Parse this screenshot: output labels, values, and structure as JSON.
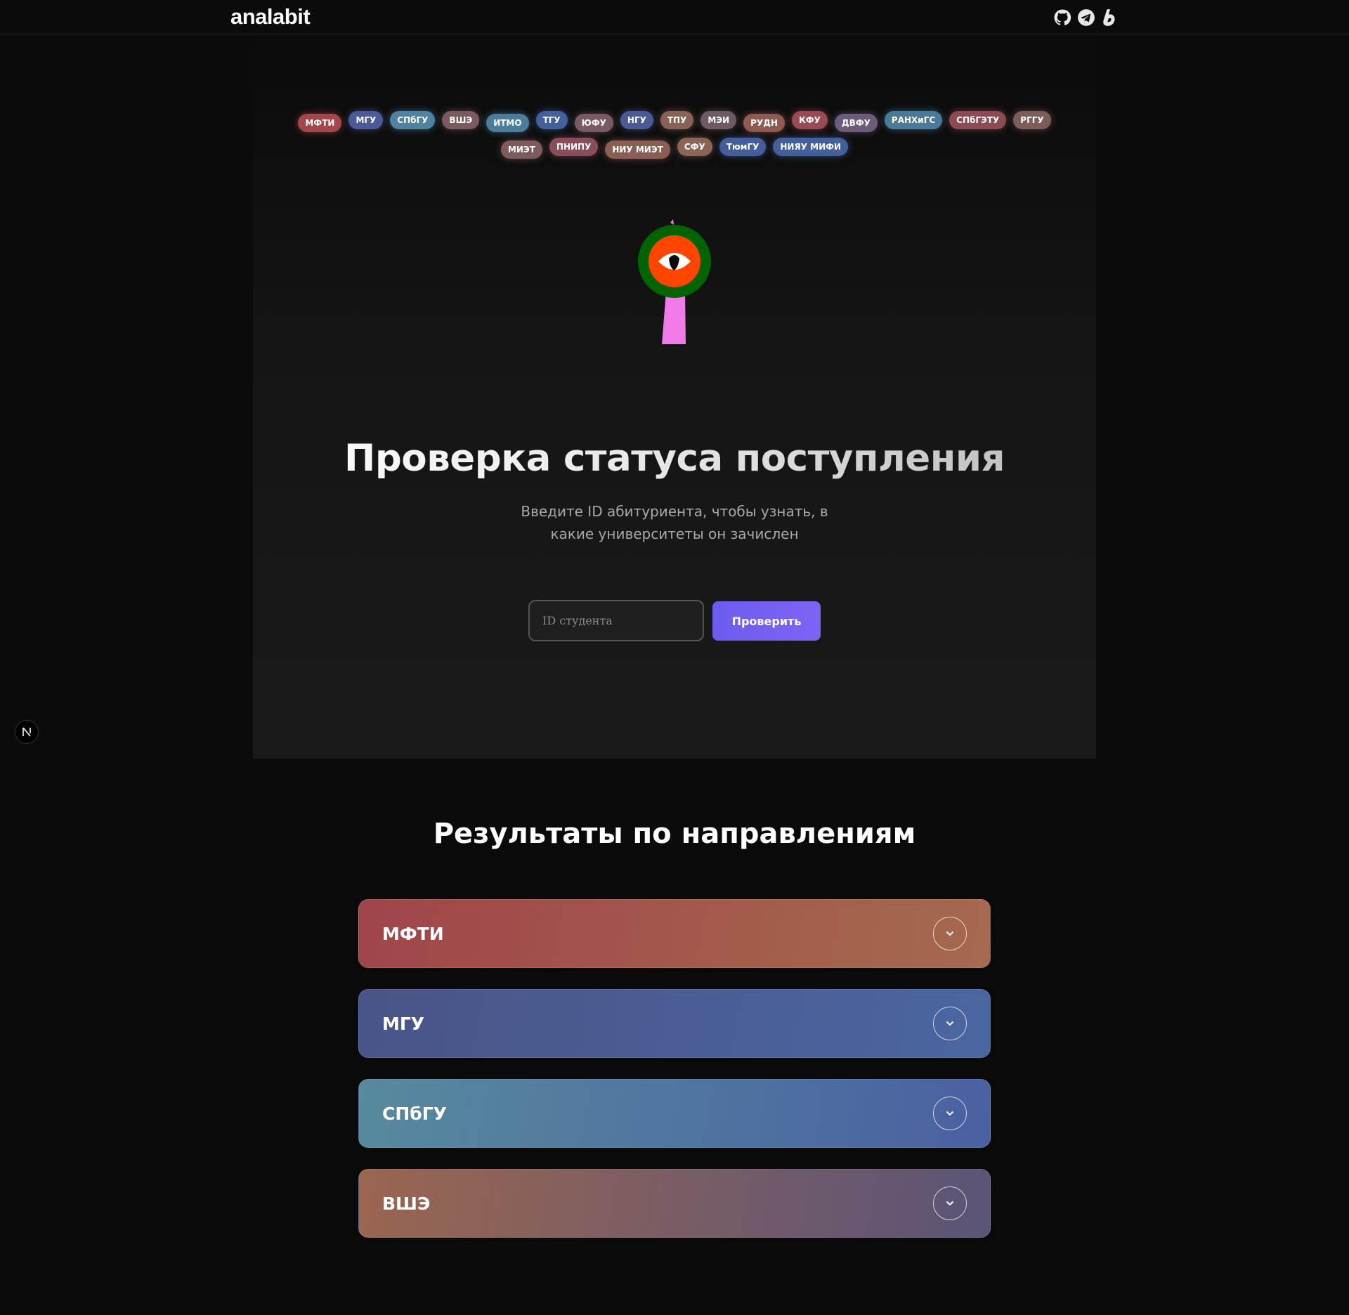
{
  "header": {
    "logo": "analabit",
    "social": [
      {
        "name": "github-icon"
      },
      {
        "name": "telegram-icon"
      },
      {
        "name": "boosty-icon"
      }
    ]
  },
  "tags": [
    {
      "label": "МФТИ",
      "color": "#a2474a"
    },
    {
      "label": "МГУ",
      "color": "#4a5a96"
    },
    {
      "label": "СПбГУ",
      "color": "#4e82a0"
    },
    {
      "label": "ВШЭ",
      "color": "#7a5a5e"
    },
    {
      "label": "ИТМО",
      "color": "#4c7e9c"
    },
    {
      "label": "ТГУ",
      "color": "#44609c"
    },
    {
      "label": "ЮФУ",
      "color": "#7a5a66"
    },
    {
      "label": "НГУ",
      "color": "#4a5a96"
    },
    {
      "label": "ТПУ",
      "color": "#8a6156"
    },
    {
      "label": "МЭИ",
      "color": "#6e5a64"
    },
    {
      "label": "РУДН",
      "color": "#8e5a52"
    },
    {
      "label": "КФУ",
      "color": "#9a4a54"
    },
    {
      "label": "ДВФУ",
      "color": "#6a5c7a"
    },
    {
      "label": "РАНХиГС",
      "color": "#4a7a98"
    },
    {
      "label": "СПбГЭТУ",
      "color": "#8c4a52"
    },
    {
      "label": "РГГУ",
      "color": "#7e5c5a"
    },
    {
      "label": "МИЭТ",
      "color": "#7e5a5a"
    },
    {
      "label": "ПНИПУ",
      "color": "#8a4e5a"
    },
    {
      "label": "НИУ МИЭТ",
      "color": "#8a5e52"
    },
    {
      "label": "СФУ",
      "color": "#8c6456"
    },
    {
      "label": "ТюмГУ",
      "color": "#445e9c"
    },
    {
      "label": "НИЯУ МИФИ",
      "color": "#44609c"
    }
  ],
  "hero": {
    "title": "Проверка статуса поступления",
    "subtitle": "Введите ID абитуриента, чтобы узнать, в какие университеты он зачислен",
    "input_placeholder": "ID студента",
    "check_button": "Проверить"
  },
  "next_badge": "N",
  "results": {
    "title": "Результаты по направлениям",
    "items": [
      {
        "label": "МФТИ",
        "from": "#a0454a",
        "to": "#a56a4e"
      },
      {
        "label": "МГУ",
        "from": "#4a5486",
        "to": "#4a66a2"
      },
      {
        "label": "СПбГУ",
        "from": "#578a9e",
        "to": "#4a60a2"
      },
      {
        "label": "ВШЭ",
        "from": "#9a6650",
        "to": "#5a5478"
      }
    ]
  }
}
